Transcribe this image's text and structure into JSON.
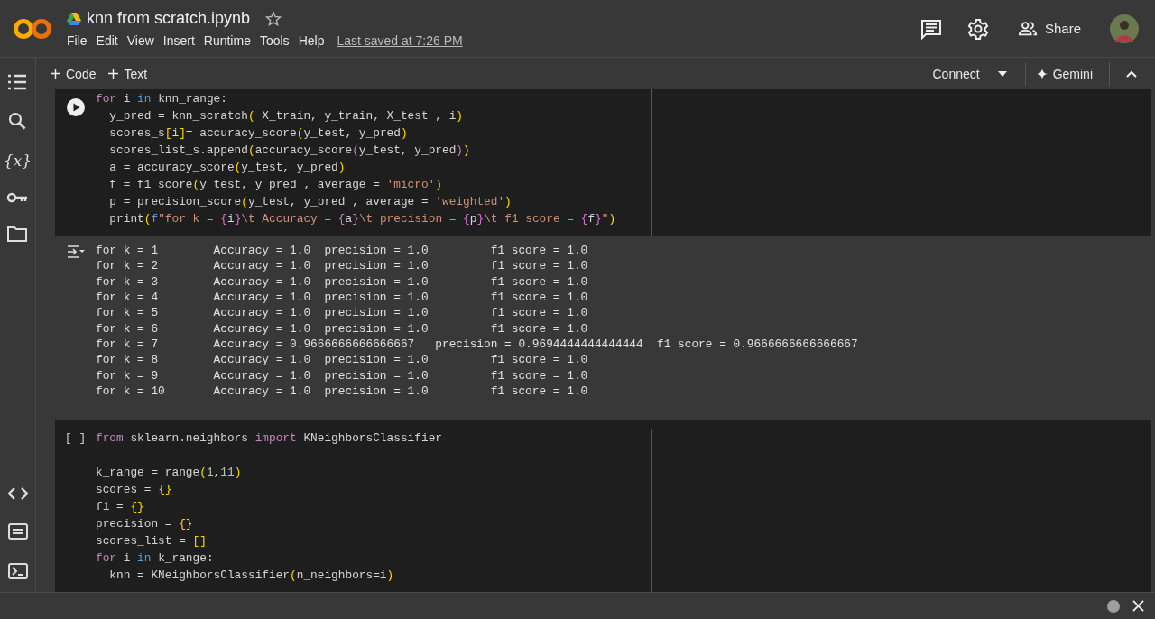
{
  "header": {
    "title": "knn from scratch.ipynb",
    "starred": false,
    "menu": [
      "File",
      "Edit",
      "View",
      "Insert",
      "Runtime",
      "Tools",
      "Help"
    ],
    "last_saved": "Last saved at 7:26 PM",
    "share": "Share"
  },
  "toolbar": {
    "add": [
      "Code",
      "Text"
    ],
    "connect": "Connect",
    "gemini": "Gemini"
  },
  "sidebar": {
    "top": [
      {
        "kind": "toc"
      },
      {
        "kind": "search"
      },
      {
        "kind": "variables",
        "text": "{x}"
      },
      {
        "kind": "secrets"
      },
      {
        "kind": "files"
      }
    ],
    "bottom": [
      {
        "kind": "snippets"
      },
      {
        "kind": "palette"
      },
      {
        "kind": "terminal"
      }
    ]
  },
  "cells": [
    {
      "gutter": {
        "kind": "run"
      },
      "lines": [
        {
          "tokens": [
            {
              "kind": "kw",
              "text": "for"
            },
            {
              "kind": "p",
              "text": " i "
            },
            {
              "kind": "kw2",
              "text": "in"
            },
            {
              "kind": "p",
              "text": " knn_range:"
            }
          ]
        },
        {
          "tokens": [
            {
              "kind": "p",
              "text": "  y_pred = knn_scratch"
            },
            {
              "kind": "b1",
              "text": "("
            },
            {
              "kind": "p",
              "text": " X_train, y_train, X_test , i"
            },
            {
              "kind": "b1",
              "text": ")"
            }
          ]
        },
        {
          "tokens": [
            {
              "kind": "p",
              "text": "  scores_s"
            },
            {
              "kind": "b1",
              "text": "["
            },
            {
              "kind": "p",
              "text": "i"
            },
            {
              "kind": "b1",
              "text": "]"
            },
            {
              "kind": "p",
              "text": "= accuracy_score"
            },
            {
              "kind": "b1",
              "text": "("
            },
            {
              "kind": "p",
              "text": "y_test, y_pred"
            },
            {
              "kind": "b1",
              "text": ")"
            }
          ]
        },
        {
          "tokens": [
            {
              "kind": "p",
              "text": "  scores_list_s.append"
            },
            {
              "kind": "b1",
              "text": "("
            },
            {
              "kind": "p",
              "text": "accuracy_score"
            },
            {
              "kind": "b2",
              "text": "("
            },
            {
              "kind": "p",
              "text": "y_test, y_pred"
            },
            {
              "kind": "b2",
              "text": ")"
            },
            {
              "kind": "b1",
              "text": ")"
            }
          ]
        },
        {
          "tokens": [
            {
              "kind": "p",
              "text": "  a = accuracy_score"
            },
            {
              "kind": "b1",
              "text": "("
            },
            {
              "kind": "p",
              "text": "y_test, y_pred"
            },
            {
              "kind": "b1",
              "text": ")"
            }
          ]
        },
        {
          "tokens": [
            {
              "kind": "p",
              "text": "  f = f1_score"
            },
            {
              "kind": "b1",
              "text": "("
            },
            {
              "kind": "p",
              "text": "y_test, y_pred , average = "
            },
            {
              "kind": "str",
              "text": "'micro'"
            },
            {
              "kind": "b1",
              "text": ")"
            }
          ]
        },
        {
          "tokens": [
            {
              "kind": "p",
              "text": "  p = precision_score"
            },
            {
              "kind": "b1",
              "text": "("
            },
            {
              "kind": "p",
              "text": "y_test, y_pred , average = "
            },
            {
              "kind": "str",
              "text": "'weighted'"
            },
            {
              "kind": "b1",
              "text": ")"
            }
          ]
        },
        {
          "tokens": [
            {
              "kind": "p",
              "text": "  print"
            },
            {
              "kind": "b1",
              "text": "("
            },
            {
              "kind": "kw2",
              "text": "f"
            },
            {
              "kind": "str",
              "text": "\"for k = "
            },
            {
              "kind": "b2",
              "text": "{"
            },
            {
              "kind": "p",
              "text": "i"
            },
            {
              "kind": "b2",
              "text": "}"
            },
            {
              "kind": "str",
              "text": "\\t Accuracy = "
            },
            {
              "kind": "b2",
              "text": "{"
            },
            {
              "kind": "p",
              "text": "a"
            },
            {
              "kind": "b2",
              "text": "}"
            },
            {
              "kind": "str",
              "text": "\\t precision = "
            },
            {
              "kind": "b2",
              "text": "{"
            },
            {
              "kind": "p",
              "text": "p"
            },
            {
              "kind": "b2",
              "text": "}"
            },
            {
              "kind": "str",
              "text": "\\t f1 score = "
            },
            {
              "kind": "b2",
              "text": "{"
            },
            {
              "kind": "p",
              "text": "f"
            },
            {
              "kind": "b2",
              "text": "}"
            },
            {
              "kind": "str",
              "text": "\""
            },
            {
              "kind": "b1",
              "text": ")"
            }
          ]
        }
      ],
      "output": {
        "lines": [
          "for k = 1        Accuracy = 1.0  precision = 1.0         f1 score = 1.0",
          "for k = 2        Accuracy = 1.0  precision = 1.0         f1 score = 1.0",
          "for k = 3        Accuracy = 1.0  precision = 1.0         f1 score = 1.0",
          "for k = 4        Accuracy = 1.0  precision = 1.0         f1 score = 1.0",
          "for k = 5        Accuracy = 1.0  precision = 1.0         f1 score = 1.0",
          "for k = 6        Accuracy = 1.0  precision = 1.0         f1 score = 1.0",
          "for k = 7        Accuracy = 0.9666666666666667   precision = 0.9694444444444444  f1 score = 0.9666666666666667",
          "for k = 8        Accuracy = 1.0  precision = 1.0         f1 score = 1.0",
          "for k = 9        Accuracy = 1.0  precision = 1.0         f1 score = 1.0",
          "for k = 10       Accuracy = 1.0  precision = 1.0         f1 score = 1.0"
        ]
      }
    },
    {
      "gutter": {
        "kind": "text",
        "text": "[ ]"
      },
      "lines": [
        {
          "tokens": [
            {
              "kind": "kw",
              "text": "from"
            },
            {
              "kind": "p",
              "text": " sklearn.neighbors "
            },
            {
              "kind": "kw",
              "text": "import"
            },
            {
              "kind": "p",
              "text": " KNeighborsClassifier"
            }
          ]
        },
        {
          "gap_before": true,
          "tokens": [
            {
              "kind": "p",
              "text": "k_range = range"
            },
            {
              "kind": "b1",
              "text": "("
            },
            {
              "kind": "num",
              "text": "1"
            },
            {
              "kind": "p",
              "text": ","
            },
            {
              "kind": "num",
              "text": "11"
            },
            {
              "kind": "b1",
              "text": ")"
            }
          ]
        },
        {
          "tokens": [
            {
              "kind": "p",
              "text": "scores = "
            },
            {
              "kind": "b1",
              "text": "{}"
            }
          ]
        },
        {
          "tokens": [
            {
              "kind": "p",
              "text": "f1 = "
            },
            {
              "kind": "b1",
              "text": "{}"
            }
          ]
        },
        {
          "tokens": [
            {
              "kind": "p",
              "text": "precision = "
            },
            {
              "kind": "b1",
              "text": "{}"
            }
          ]
        },
        {
          "tokens": [
            {
              "kind": "p",
              "text": "scores_list = "
            },
            {
              "kind": "b1",
              "text": "[]"
            }
          ]
        },
        {
          "tokens": [
            {
              "kind": "kw",
              "text": "for"
            },
            {
              "kind": "p",
              "text": " i "
            },
            {
              "kind": "kw2",
              "text": "in"
            },
            {
              "kind": "p",
              "text": " k_range:"
            }
          ]
        },
        {
          "tokens": [
            {
              "kind": "p",
              "text": "  knn = KNeighborsClassifier"
            },
            {
              "kind": "b1",
              "text": "("
            },
            {
              "kind": "p",
              "text": "n_neighbors=i"
            },
            {
              "kind": "b1",
              "text": ")"
            }
          ]
        }
      ]
    }
  ]
}
